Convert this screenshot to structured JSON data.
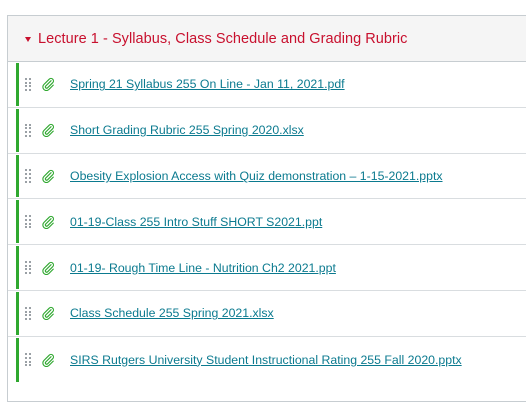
{
  "module": {
    "title": "Lecture 1 - Syllabus, Class Schedule and Grading Rubric",
    "collapse_icon": "caret-down-icon",
    "accent_color": "#c8102e",
    "published_color": "#2fa82f",
    "link_color": "#0b7a8f",
    "items": [
      {
        "label": "Spring 21 Syllabus 255 On Line - Jan 11, 2021.pdf",
        "icon": "paperclip-icon"
      },
      {
        "label": "Short Grading Rubric 255 Spring 2020.xlsx",
        "icon": "paperclip-icon"
      },
      {
        "label": "Obesity Explosion Access with Quiz demonstration – 1-15-2021.pptx",
        "icon": "paperclip-icon"
      },
      {
        "label": "01-19-Class 255 Intro Stuff SHORT S2021.ppt",
        "icon": "paperclip-icon"
      },
      {
        "label": "01-19- Rough Time Line - Nutrition Ch2 2021.ppt",
        "icon": "paperclip-icon"
      },
      {
        "label": "Class Schedule 255 Spring 2021.xlsx",
        "icon": "paperclip-icon"
      },
      {
        "label": "SIRS Rutgers University Student Instructional Rating 255 Fall 2020.pptx",
        "icon": "paperclip-icon"
      }
    ]
  }
}
